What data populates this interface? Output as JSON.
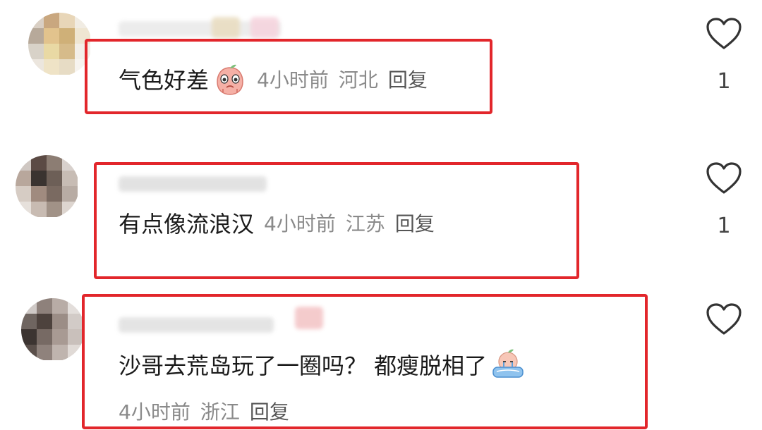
{
  "comments": [
    {
      "text": "气色好差",
      "emoji": "crying-peach-emoji",
      "time": "4小时前",
      "location": "河北",
      "reply": "回复",
      "likes": "1"
    },
    {
      "text": "有点像流浪汉",
      "time": "4小时前",
      "location": "江苏",
      "reply": "回复",
      "likes": "1"
    },
    {
      "text": "沙哥去荒岛玩了一圈吗？ 都瘦脱相了",
      "emoji": "crying-in-bath-emoji",
      "time": "4小时前",
      "location": "浙江",
      "reply": "回复",
      "likes": ""
    }
  ],
  "colors": {
    "highlight": "#e2262b",
    "meta_text": "#8a8a8a",
    "icon": "#333333"
  }
}
